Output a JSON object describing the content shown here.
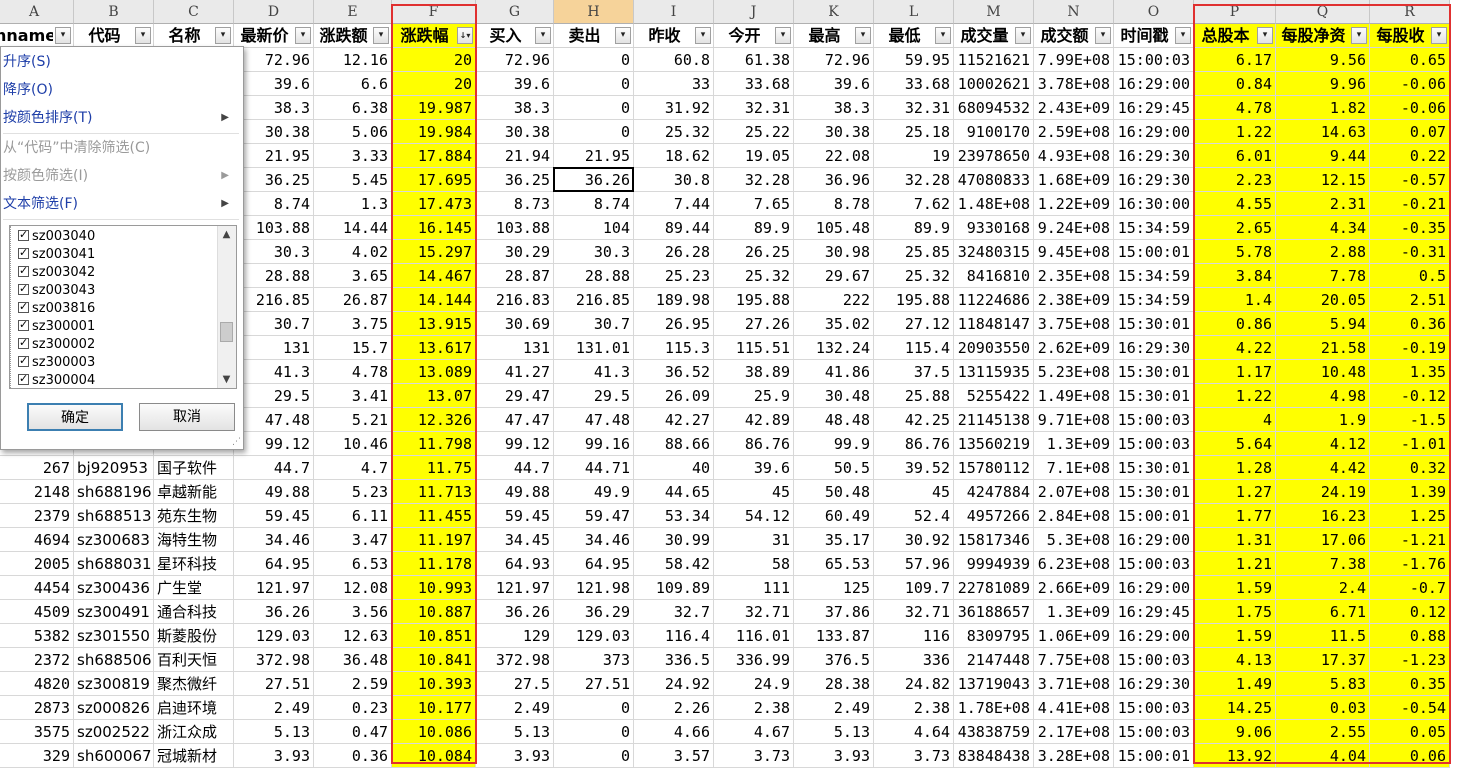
{
  "columns": [
    {
      "letter": "A",
      "header": "nnamed",
      "width": 79,
      "type": "num"
    },
    {
      "letter": "B",
      "header": "代码",
      "width": 80,
      "type": "txt"
    },
    {
      "letter": "C",
      "header": "名称",
      "width": 80,
      "type": "txt"
    },
    {
      "letter": "D",
      "header": "最新价",
      "width": 80,
      "type": "num"
    },
    {
      "letter": "E",
      "header": "涨跌额",
      "width": 78,
      "type": "num"
    },
    {
      "letter": "F",
      "header": "涨跌幅",
      "width": 84,
      "type": "num",
      "highlight": true,
      "sorted": true
    },
    {
      "letter": "G",
      "header": "买入",
      "width": 78,
      "type": "num"
    },
    {
      "letter": "H",
      "header": "卖出",
      "width": 80,
      "type": "num",
      "selected": true
    },
    {
      "letter": "I",
      "header": "昨收",
      "width": 80,
      "type": "num"
    },
    {
      "letter": "J",
      "header": "今开",
      "width": 80,
      "type": "num"
    },
    {
      "letter": "K",
      "header": "最高",
      "width": 80,
      "type": "num"
    },
    {
      "letter": "L",
      "header": "最低",
      "width": 80,
      "type": "num"
    },
    {
      "letter": "M",
      "header": "成交量",
      "width": 80,
      "type": "num"
    },
    {
      "letter": "N",
      "header": "成交额",
      "width": 80,
      "type": "num"
    },
    {
      "letter": "O",
      "header": "时间戳",
      "width": 80,
      "type": "num"
    },
    {
      "letter": "P",
      "header": "总股本",
      "width": 82,
      "type": "num",
      "highlight": true
    },
    {
      "letter": "Q",
      "header": "每股净资",
      "width": 94,
      "type": "num",
      "highlight": true
    },
    {
      "letter": "R",
      "header": "每股收",
      "width": 80,
      "type": "num",
      "highlight": true
    }
  ],
  "rows": [
    [
      "",
      "",
      "",
      "72.96",
      "12.16",
      "20",
      "72.96",
      "0",
      "60.8",
      "61.38",
      "72.96",
      "59.95",
      "11521621",
      "7.99E+08",
      "15:00:03",
      "6.17",
      "9.56",
      "0.65"
    ],
    [
      "",
      "",
      "",
      "39.6",
      "6.6",
      "20",
      "39.6",
      "0",
      "33",
      "33.68",
      "39.6",
      "33.68",
      "10002621",
      "3.78E+08",
      "16:29:00",
      "0.84",
      "9.96",
      "-0.06"
    ],
    [
      "",
      "",
      "",
      "38.3",
      "6.38",
      "19.987",
      "38.3",
      "0",
      "31.92",
      "32.31",
      "38.3",
      "32.31",
      "68094532",
      "2.43E+09",
      "16:29:45",
      "4.78",
      "1.82",
      "-0.06"
    ],
    [
      "",
      "",
      "",
      "30.38",
      "5.06",
      "19.984",
      "30.38",
      "0",
      "25.32",
      "25.22",
      "30.38",
      "25.18",
      "9100170",
      "2.59E+08",
      "16:29:00",
      "1.22",
      "14.63",
      "0.07"
    ],
    [
      "",
      "",
      "",
      "21.95",
      "3.33",
      "17.884",
      "21.94",
      "21.95",
      "18.62",
      "19.05",
      "22.08",
      "19",
      "23978650",
      "4.93E+08",
      "16:29:30",
      "6.01",
      "9.44",
      "0.22"
    ],
    [
      "",
      "",
      "",
      "36.25",
      "5.45",
      "17.695",
      "36.25",
      "36.26",
      "30.8",
      "32.28",
      "36.96",
      "32.28",
      "47080833",
      "1.68E+09",
      "16:29:30",
      "2.23",
      "12.15",
      "-0.57"
    ],
    [
      "",
      "",
      "",
      "8.74",
      "1.3",
      "17.473",
      "8.73",
      "8.74",
      "7.44",
      "7.65",
      "8.78",
      "7.62",
      "1.48E+08",
      "1.22E+09",
      "16:30:00",
      "4.55",
      "2.31",
      "-0.21"
    ],
    [
      "",
      "",
      "",
      "103.88",
      "14.44",
      "16.145",
      "103.88",
      "104",
      "89.44",
      "89.9",
      "105.48",
      "89.9",
      "9330168",
      "9.24E+08",
      "15:34:59",
      "2.65",
      "4.34",
      "-0.35"
    ],
    [
      "",
      "",
      "",
      "30.3",
      "4.02",
      "15.297",
      "30.29",
      "30.3",
      "26.28",
      "26.25",
      "30.98",
      "25.85",
      "32480315",
      "9.45E+08",
      "15:00:01",
      "5.78",
      "2.88",
      "-0.31"
    ],
    [
      "",
      "",
      "",
      "28.88",
      "3.65",
      "14.467",
      "28.87",
      "28.88",
      "25.23",
      "25.32",
      "29.67",
      "25.32",
      "8416810",
      "2.35E+08",
      "15:34:59",
      "3.84",
      "7.78",
      "0.5"
    ],
    [
      "",
      "",
      "",
      "216.85",
      "26.87",
      "14.144",
      "216.83",
      "216.85",
      "189.98",
      "195.88",
      "222",
      "195.88",
      "11224686",
      "2.38E+09",
      "15:34:59",
      "1.4",
      "20.05",
      "2.51"
    ],
    [
      "",
      "",
      "",
      "30.7",
      "3.75",
      "13.915",
      "30.69",
      "30.7",
      "26.95",
      "27.26",
      "35.02",
      "27.12",
      "11848147",
      "3.75E+08",
      "15:30:01",
      "0.86",
      "5.94",
      "0.36"
    ],
    [
      "",
      "",
      "",
      "131",
      "15.7",
      "13.617",
      "131",
      "131.01",
      "115.3",
      "115.51",
      "132.24",
      "115.4",
      "20903550",
      "2.62E+09",
      "16:29:30",
      "4.22",
      "21.58",
      "-0.19"
    ],
    [
      "",
      "",
      "",
      "41.3",
      "4.78",
      "13.089",
      "41.27",
      "41.3",
      "36.52",
      "38.89",
      "41.86",
      "37.5",
      "13115935",
      "5.23E+08",
      "15:30:01",
      "1.17",
      "10.48",
      "1.35"
    ],
    [
      "",
      "",
      "",
      "29.5",
      "3.41",
      "13.07",
      "29.47",
      "29.5",
      "26.09",
      "25.9",
      "30.48",
      "25.88",
      "5255422",
      "1.49E+08",
      "15:30:01",
      "1.22",
      "4.98",
      "-0.12"
    ],
    [
      "",
      "",
      "",
      "47.48",
      "5.21",
      "12.326",
      "47.47",
      "47.48",
      "42.27",
      "42.89",
      "48.48",
      "42.25",
      "21145138",
      "9.71E+08",
      "15:00:03",
      "4",
      "1.9",
      "-1.5"
    ],
    [
      "",
      "",
      "",
      "99.12",
      "10.46",
      "11.798",
      "99.12",
      "99.16",
      "88.66",
      "86.76",
      "99.9",
      "86.76",
      "13560219",
      "1.3E+09",
      "15:00:03",
      "5.64",
      "4.12",
      "-1.01"
    ],
    [
      "267",
      "bj920953",
      "国子软件",
      "44.7",
      "4.7",
      "11.75",
      "44.7",
      "44.71",
      "40",
      "39.6",
      "50.5",
      "39.52",
      "15780112",
      "7.1E+08",
      "15:30:01",
      "1.28",
      "4.42",
      "0.32"
    ],
    [
      "2148",
      "sh688196",
      "卓越新能",
      "49.88",
      "5.23",
      "11.713",
      "49.88",
      "49.9",
      "44.65",
      "45",
      "50.48",
      "45",
      "4247884",
      "2.07E+08",
      "15:30:01",
      "1.27",
      "24.19",
      "1.39"
    ],
    [
      "2379",
      "sh688513",
      "苑东生物",
      "59.45",
      "6.11",
      "11.455",
      "59.45",
      "59.47",
      "53.34",
      "54.12",
      "60.49",
      "52.4",
      "4957266",
      "2.84E+08",
      "15:00:01",
      "1.77",
      "16.23",
      "1.25"
    ],
    [
      "4694",
      "sz300683",
      "海特生物",
      "34.46",
      "3.47",
      "11.197",
      "34.45",
      "34.46",
      "30.99",
      "31",
      "35.17",
      "30.92",
      "15817346",
      "5.3E+08",
      "16:29:00",
      "1.31",
      "17.06",
      "-1.21"
    ],
    [
      "2005",
      "sh688031",
      "星环科技",
      "64.95",
      "6.53",
      "11.178",
      "64.93",
      "64.95",
      "58.42",
      "58",
      "65.53",
      "57.96",
      "9994939",
      "6.23E+08",
      "15:00:03",
      "1.21",
      "7.38",
      "-1.76"
    ],
    [
      "4454",
      "sz300436",
      "广生堂",
      "121.97",
      "12.08",
      "10.993",
      "121.97",
      "121.98",
      "109.89",
      "111",
      "125",
      "109.7",
      "22781089",
      "2.66E+09",
      "16:29:00",
      "1.59",
      "2.4",
      "-0.7"
    ],
    [
      "4509",
      "sz300491",
      "通合科技",
      "36.26",
      "3.56",
      "10.887",
      "36.26",
      "36.29",
      "32.7",
      "32.71",
      "37.86",
      "32.71",
      "36188657",
      "1.3E+09",
      "16:29:45",
      "1.75",
      "6.71",
      "0.12"
    ],
    [
      "5382",
      "sz301550",
      "斯菱股份",
      "129.03",
      "12.63",
      "10.851",
      "129",
      "129.03",
      "116.4",
      "116.01",
      "133.87",
      "116",
      "8309795",
      "1.06E+09",
      "16:29:00",
      "1.59",
      "11.5",
      "0.88"
    ],
    [
      "2372",
      "sh688506",
      "百利天恒",
      "372.98",
      "36.48",
      "10.841",
      "372.98",
      "373",
      "336.5",
      "336.99",
      "376.5",
      "336",
      "2147448",
      "7.75E+08",
      "15:00:03",
      "4.13",
      "17.37",
      "-1.23"
    ],
    [
      "4820",
      "sz300819",
      "聚杰微纤",
      "27.51",
      "2.59",
      "10.393",
      "27.5",
      "27.51",
      "24.92",
      "24.9",
      "28.38",
      "24.82",
      "13719043",
      "3.71E+08",
      "16:29:30",
      "1.49",
      "5.83",
      "0.35"
    ],
    [
      "2873",
      "sz000826",
      "启迪环境",
      "2.49",
      "0.23",
      "10.177",
      "2.49",
      "0",
      "2.26",
      "2.38",
      "2.49",
      "2.38",
      "1.78E+08",
      "4.41E+08",
      "15:00:03",
      "14.25",
      "0.03",
      "-0.54"
    ],
    [
      "3575",
      "sz002522",
      "浙江众成",
      "5.13",
      "0.47",
      "10.086",
      "5.13",
      "0",
      "4.66",
      "4.67",
      "5.13",
      "4.64",
      "43838759",
      "2.17E+08",
      "15:00:03",
      "9.06",
      "2.55",
      "0.05"
    ],
    [
      "329",
      "sh600067",
      "冠城新材",
      "3.93",
      "0.36",
      "10.084",
      "3.93",
      "0",
      "3.57",
      "3.73",
      "3.93",
      "3.73",
      "83848438",
      "3.28E+08",
      "15:00:01",
      "13.92",
      "4.04",
      "0.06"
    ]
  ],
  "filter_menu": {
    "sort_asc": "升序(S)",
    "sort_desc": "降序(O)",
    "sort_color": "按颜色排序(T)",
    "clear_filter": "从“代码”中清除筛选(C)",
    "filter_color": "按颜色筛选(I)",
    "text_filter": "文本筛选(F)",
    "items": [
      "sz003040",
      "sz003041",
      "sz003042",
      "sz003043",
      "sz003816",
      "sz300001",
      "sz300002",
      "sz300003",
      "sz300004"
    ],
    "ok_label": "确定",
    "cancel_label": "取消"
  },
  "colors": {
    "highlight": "#ffff00",
    "frame": "#e03030",
    "link": "#1e3ea8"
  }
}
